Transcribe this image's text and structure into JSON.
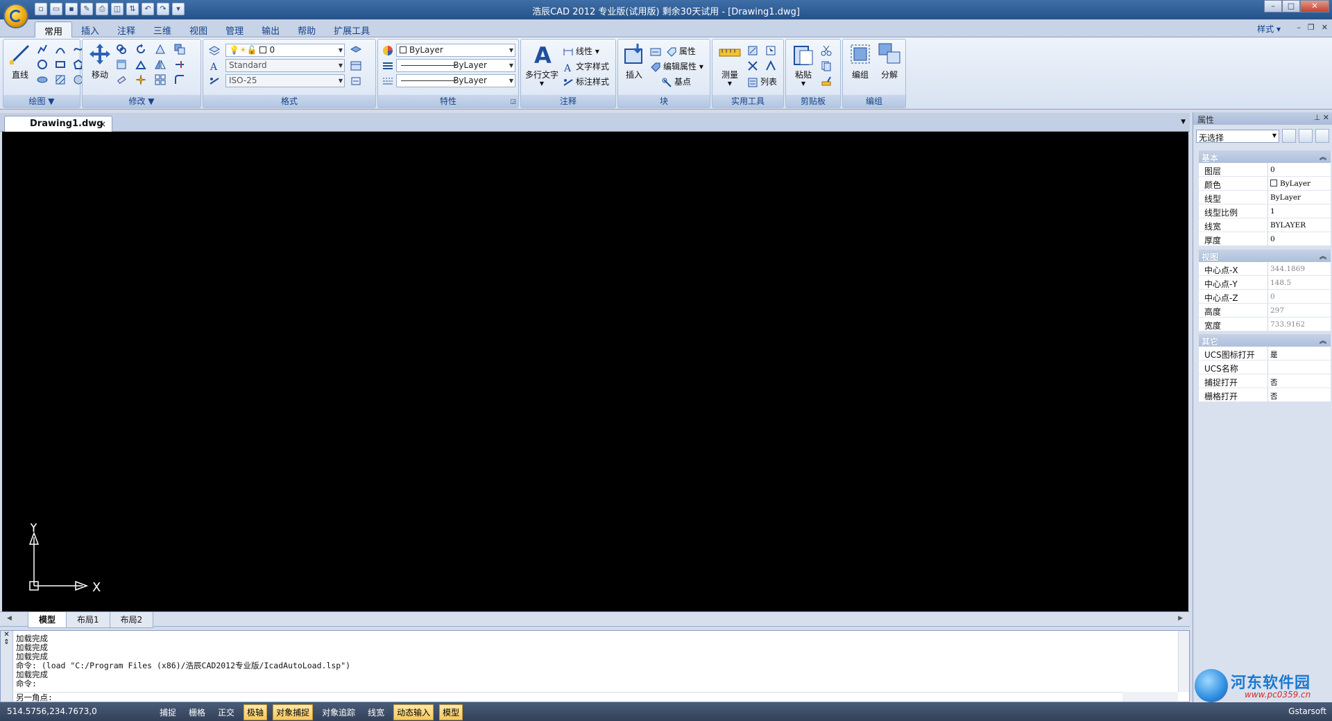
{
  "window": {
    "title": "浩辰CAD 2012 专业版(试用版) 剩余30天试用 - [Drawing1.dwg]",
    "controls": [
      "–",
      "□",
      "✕"
    ]
  },
  "ribbon": {
    "tabs": [
      "常用",
      "插入",
      "注释",
      "三维",
      "视图",
      "管理",
      "输出",
      "帮助",
      "扩展工具"
    ],
    "active_tab": "常用",
    "style_menu": "样式",
    "groups": {
      "draw": {
        "label": "绘图",
        "line_label": "直线"
      },
      "modify": {
        "label": "修改",
        "move_label": "移动"
      },
      "format": {
        "label": "格式",
        "layer_value": "0",
        "text_style": "Standard",
        "dim_style": "ISO-25"
      },
      "properties": {
        "label": "特性",
        "color_value": "ByLayer",
        "linetype_value": "ByLayer",
        "lineweight_value": "ByLayer"
      },
      "annotation": {
        "label": "注释",
        "mtext_label": "多行文字",
        "linear_label": "线性",
        "textstyle_label": "文字样式",
        "dimstyle_label": "标注样式"
      },
      "block": {
        "label": "块",
        "insert_label": "插入",
        "attr_label": "属性",
        "editattr_label": "编辑属性",
        "basepoint_label": "基点"
      },
      "utilities": {
        "label": "实用工具",
        "measure_label": "测量",
        "list_label": "列表"
      },
      "clipboard": {
        "label": "剪贴板",
        "paste_label": "粘贴"
      },
      "group": {
        "label": "编组",
        "group_label": "编组",
        "explode_label": "分解"
      }
    }
  },
  "document": {
    "tab_name": "Drawing1.dwg",
    "close": "×"
  },
  "ucs": {
    "x_label": "X",
    "y_label": "Y"
  },
  "layout_tabs": [
    "模型",
    "布局1",
    "布局2"
  ],
  "command": {
    "history": [
      "加载完成",
      "加载完成",
      "加载完成",
      "命令: (load \"C:/Program Files (x86)/浩辰CAD2012专业版/IcadAutoLoad.lsp\")",
      "加载完成",
      "命令:"
    ],
    "prompt": "另一角点:"
  },
  "status": {
    "coords": "514.5756,234.7673,0",
    "toggles": [
      {
        "label": "捕捉",
        "on": false
      },
      {
        "label": "栅格",
        "on": false
      },
      {
        "label": "正交",
        "on": false
      },
      {
        "label": "极轴",
        "on": true
      },
      {
        "label": "对象捕捉",
        "on": true
      },
      {
        "label": "对象追踪",
        "on": false
      },
      {
        "label": "线宽",
        "on": false
      },
      {
        "label": "动态输入",
        "on": true
      },
      {
        "label": "模型",
        "on": true
      }
    ],
    "brand": "Gstarsoft"
  },
  "properties": {
    "title": "属性",
    "selector": "无选择",
    "basic": {
      "title": "基本",
      "rows": [
        {
          "key": "图层",
          "value": "0"
        },
        {
          "key": "颜色",
          "value": "ByLayer"
        },
        {
          "key": "线型",
          "value": "ByLayer"
        },
        {
          "key": "线型比例",
          "value": "1"
        },
        {
          "key": "线宽",
          "value": "BYLAYER"
        },
        {
          "key": "厚度",
          "value": "0"
        }
      ]
    },
    "view": {
      "title": "视图",
      "rows": [
        {
          "key": "中心点-X",
          "value": "344.1869"
        },
        {
          "key": "中心点-Y",
          "value": "148.5"
        },
        {
          "key": "中心点-Z",
          "value": "0"
        },
        {
          "key": "高度",
          "value": "297"
        },
        {
          "key": "宽度",
          "value": "733.9162"
        }
      ]
    },
    "other": {
      "title": "其它",
      "rows": [
        {
          "key": "UCS图标打开",
          "value": "是"
        },
        {
          "key": "UCS名称",
          "value": ""
        },
        {
          "key": "捕捉打开",
          "value": "否"
        },
        {
          "key": "栅格打开",
          "value": "否"
        }
      ]
    }
  },
  "watermark": {
    "title": "河东软件园",
    "url": "www.pc0359.cn"
  },
  "colors": {
    "accent": "#15428b",
    "canvas": "#000000",
    "toggle_on": "#f7c75a"
  }
}
